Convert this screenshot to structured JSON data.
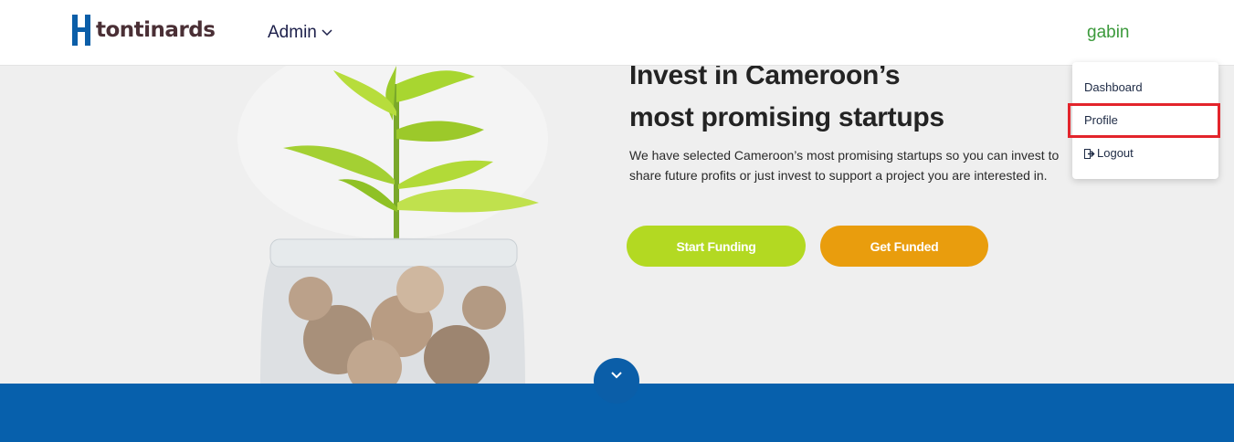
{
  "header": {
    "brand": "tontinards",
    "nav_admin": "Admin",
    "user_name": "gabin"
  },
  "hero": {
    "title_line1": "Invest in Cameroon’s",
    "title_line2": "most promising startups",
    "description": "We have selected Cameroon’s most promising startups so you can invest to share future profits or just invest to support a project you are interested in.",
    "start_funding": "Start Funding",
    "get_funded": "Get Funded"
  },
  "user_menu": {
    "dashboard": "Dashboard",
    "profile": "Profile",
    "logout": "Logout"
  },
  "colors": {
    "brand_blue": "#0760ac",
    "start_green": "#b3d922",
    "funded_orange": "#e99d0d",
    "user_green": "#3c9a3c",
    "highlight_red": "#e3242b"
  }
}
